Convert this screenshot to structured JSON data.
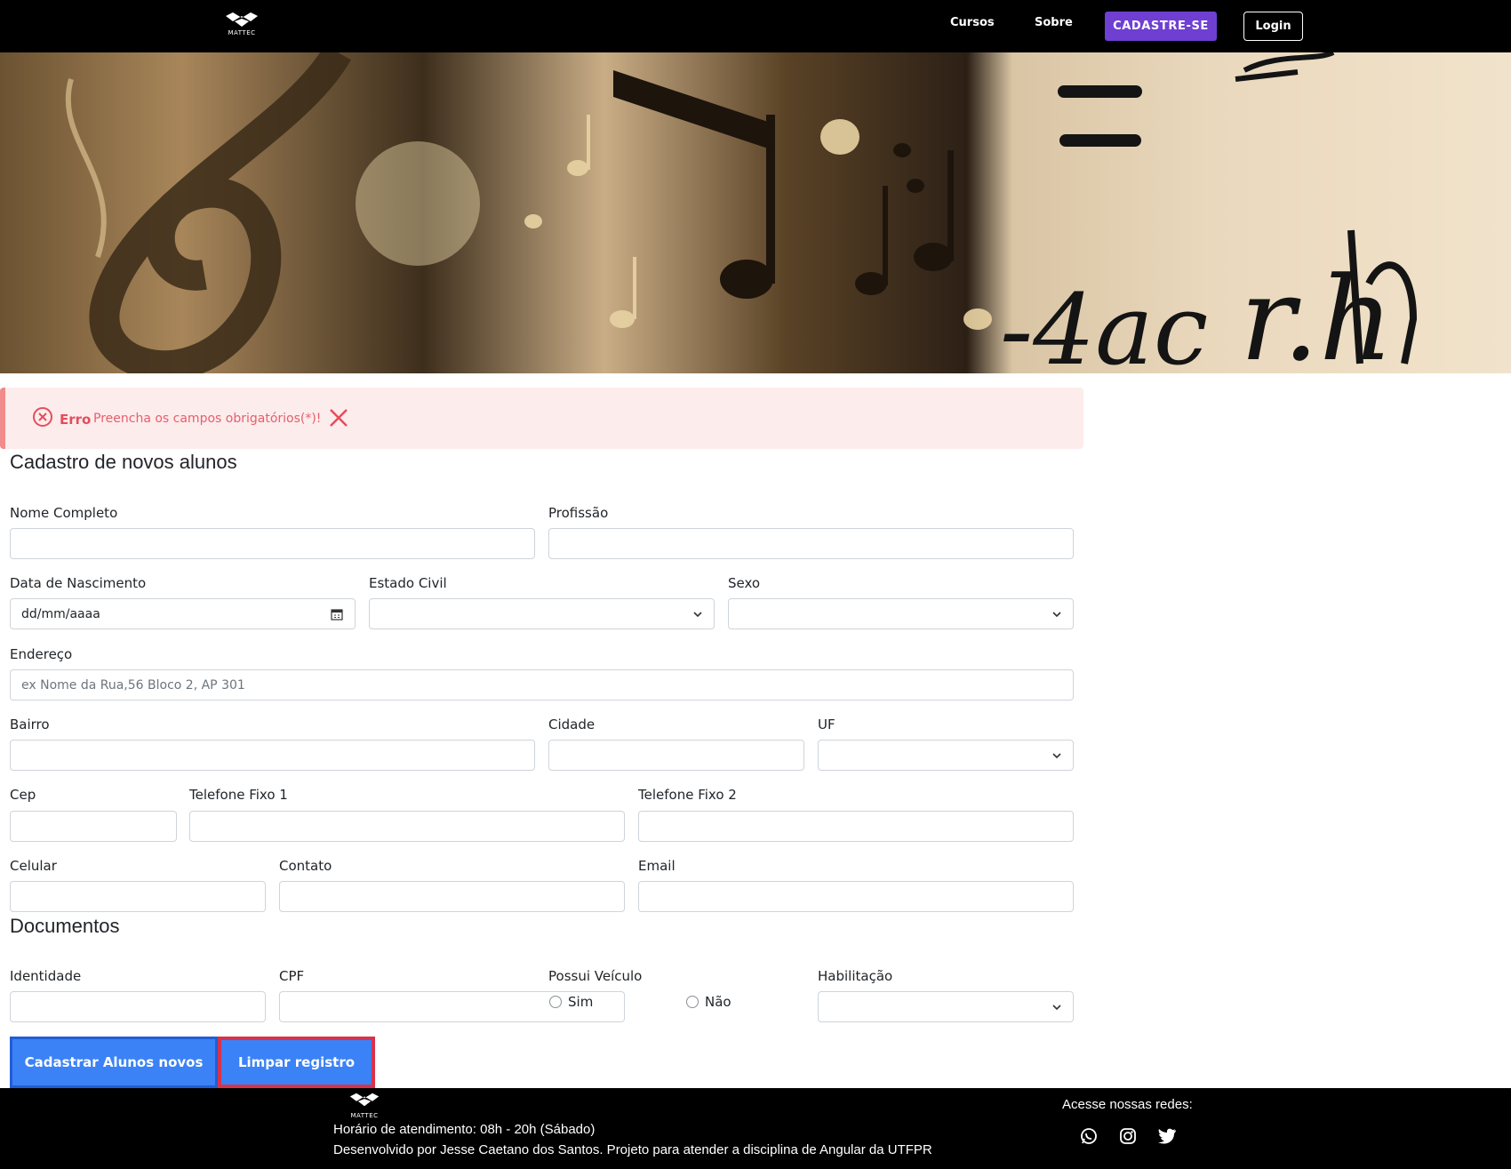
{
  "nav": {
    "logo_text": "MATTEC",
    "links": [
      "Cursos",
      "Sobre"
    ],
    "signup_label": "CADASTRE-SE",
    "login_label": "Login"
  },
  "hero": {
    "image_desc": "music notes and math formula banner"
  },
  "alert": {
    "title": "Erro",
    "message": "Preencha os campos obrigatórios(*)!"
  },
  "form": {
    "title": "Cadastro de novos alunos",
    "labels": {
      "nome": "Nome Completo",
      "profissao": "Profissão",
      "nascimento": "Data de Nascimento",
      "estado_civil": "Estado Civil",
      "sexo": "Sexo",
      "endereco": "Endereço",
      "bairro": "Bairro",
      "cidade": "Cidade",
      "uf": "UF",
      "cep": "Cep",
      "tel1": "Telefone Fixo 1",
      "tel2": "Telefone Fixo 2",
      "celular": "Celular",
      "contato": "Contato",
      "email": "Email"
    },
    "placeholders": {
      "nascimento": "dd/mm/aaaa",
      "endereco": "ex Nome da Rua,56 Bloco 2, AP 301"
    }
  },
  "documentos": {
    "title": "Documentos",
    "labels": {
      "identidade": "Identidade",
      "cpf": "CPF",
      "veiculo": "Possui Veículo",
      "habilitacao": "Habilitação"
    },
    "veiculo_options": [
      "Sim",
      "Não"
    ]
  },
  "buttons": {
    "submit": "Cadastrar Alunos novos",
    "clear": "Limpar registro"
  },
  "footer": {
    "logo_text": "MATTEC",
    "hours": "Horário de atendimento: 08h - 20h (Sábado)",
    "developer": "Desenvolvido por Jesse Caetano dos Santos. Projeto para atender a disciplina de Angular da UTFPR",
    "social_title": "Acesse nossas redes:",
    "social_icons": [
      "whatsapp-icon",
      "instagram-icon",
      "twitter-icon"
    ]
  },
  "colors": {
    "signup": "#6f3fd1",
    "alert_bg": "#fdecec",
    "alert_text": "#e44d5b",
    "primary": "#3b82f6",
    "clear_border": "#d8334a"
  }
}
